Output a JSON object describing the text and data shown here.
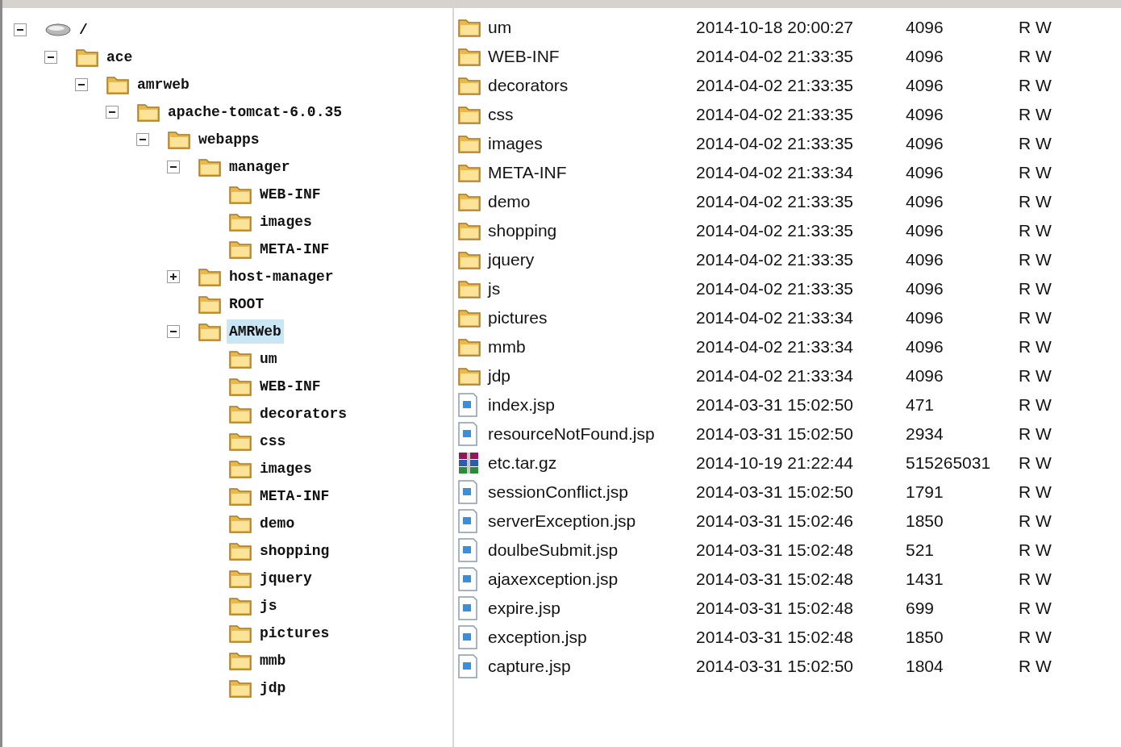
{
  "tree": [
    {
      "label": "/",
      "kind": "drive",
      "expanded": true,
      "selected": false,
      "children": [
        {
          "label": "ace",
          "kind": "folder",
          "expanded": true,
          "selected": false,
          "children": [
            {
              "label": "amrweb",
              "kind": "folder",
              "expanded": true,
              "selected": false,
              "children": [
                {
                  "label": "apache-tomcat-6.0.35",
                  "kind": "folder",
                  "expanded": true,
                  "selected": false,
                  "children": [
                    {
                      "label": "webapps",
                      "kind": "folder",
                      "expanded": true,
                      "selected": false,
                      "children": [
                        {
                          "label": "manager",
                          "kind": "folder",
                          "expanded": true,
                          "selected": false,
                          "children": [
                            {
                              "label": "WEB-INF",
                              "kind": "folder",
                              "selected": false
                            },
                            {
                              "label": "images",
                              "kind": "folder",
                              "selected": false
                            },
                            {
                              "label": "META-INF",
                              "kind": "folder",
                              "selected": false
                            }
                          ]
                        },
                        {
                          "label": "host-manager",
                          "kind": "folder",
                          "expanded": false,
                          "selected": false
                        },
                        {
                          "label": "ROOT",
                          "kind": "folder",
                          "selected": false
                        },
                        {
                          "label": "AMRWeb",
                          "kind": "folder",
                          "expanded": true,
                          "selected": true,
                          "children": [
                            {
                              "label": "um",
                              "kind": "folder",
                              "selected": false
                            },
                            {
                              "label": "WEB-INF",
                              "kind": "folder",
                              "selected": false
                            },
                            {
                              "label": "decorators",
                              "kind": "folder",
                              "selected": false
                            },
                            {
                              "label": "css",
                              "kind": "folder",
                              "selected": false
                            },
                            {
                              "label": "images",
                              "kind": "folder",
                              "selected": false
                            },
                            {
                              "label": "META-INF",
                              "kind": "folder",
                              "selected": false
                            },
                            {
                              "label": "demo",
                              "kind": "folder",
                              "selected": false
                            },
                            {
                              "label": "shopping",
                              "kind": "folder",
                              "selected": false
                            },
                            {
                              "label": "jquery",
                              "kind": "folder",
                              "selected": false
                            },
                            {
                              "label": "js",
                              "kind": "folder",
                              "selected": false
                            },
                            {
                              "label": "pictures",
                              "kind": "folder",
                              "selected": false
                            },
                            {
                              "label": "mmb",
                              "kind": "folder",
                              "selected": false
                            },
                            {
                              "label": "jdp",
                              "kind": "folder",
                              "selected": false
                            }
                          ]
                        }
                      ]
                    }
                  ]
                }
              ]
            }
          ]
        }
      ]
    }
  ],
  "files": [
    {
      "kind": "folder",
      "name": "um",
      "modified": "2014-10-18 20:00:27",
      "size": "4096",
      "access": "R W"
    },
    {
      "kind": "folder",
      "name": "WEB-INF",
      "modified": "2014-04-02 21:33:35",
      "size": "4096",
      "access": "R W"
    },
    {
      "kind": "folder",
      "name": "decorators",
      "modified": "2014-04-02 21:33:35",
      "size": "4096",
      "access": "R W"
    },
    {
      "kind": "folder",
      "name": "css",
      "modified": "2014-04-02 21:33:35",
      "size": "4096",
      "access": "R W"
    },
    {
      "kind": "folder",
      "name": "images",
      "modified": "2014-04-02 21:33:35",
      "size": "4096",
      "access": "R W"
    },
    {
      "kind": "folder",
      "name": "META-INF",
      "modified": "2014-04-02 21:33:34",
      "size": "4096",
      "access": "R W"
    },
    {
      "kind": "folder",
      "name": "demo",
      "modified": "2014-04-02 21:33:35",
      "size": "4096",
      "access": "R W"
    },
    {
      "kind": "folder",
      "name": "shopping",
      "modified": "2014-04-02 21:33:35",
      "size": "4096",
      "access": "R W"
    },
    {
      "kind": "folder",
      "name": "jquery",
      "modified": "2014-04-02 21:33:35",
      "size": "4096",
      "access": "R W"
    },
    {
      "kind": "folder",
      "name": "js",
      "modified": "2014-04-02 21:33:35",
      "size": "4096",
      "access": "R W"
    },
    {
      "kind": "folder",
      "name": "pictures",
      "modified": "2014-04-02 21:33:34",
      "size": "4096",
      "access": "R W"
    },
    {
      "kind": "folder",
      "name": "mmb",
      "modified": "2014-04-02 21:33:34",
      "size": "4096",
      "access": "R W"
    },
    {
      "kind": "folder",
      "name": "jdp",
      "modified": "2014-04-02 21:33:34",
      "size": "4096",
      "access": "R W"
    },
    {
      "kind": "file",
      "name": "index.jsp",
      "modified": "2014-03-31 15:02:50",
      "size": "471",
      "access": "R W"
    },
    {
      "kind": "file",
      "name": "resourceNotFound.jsp",
      "modified": "2014-03-31 15:02:50",
      "size": "2934",
      "access": "R W"
    },
    {
      "kind": "archive",
      "name": "etc.tar.gz",
      "modified": "2014-10-19 21:22:44",
      "size": "515265031",
      "access": "R W"
    },
    {
      "kind": "file",
      "name": "sessionConflict.jsp",
      "modified": "2014-03-31 15:02:50",
      "size": "1791",
      "access": "R W"
    },
    {
      "kind": "file",
      "name": "serverException.jsp",
      "modified": "2014-03-31 15:02:46",
      "size": "1850",
      "access": "R W"
    },
    {
      "kind": "file",
      "name": "doulbeSubmit.jsp",
      "modified": "2014-03-31 15:02:48",
      "size": "521",
      "access": "R W"
    },
    {
      "kind": "file",
      "name": "ajaxexception.jsp",
      "modified": "2014-03-31 15:02:48",
      "size": "1431",
      "access": "R W"
    },
    {
      "kind": "file",
      "name": "expire.jsp",
      "modified": "2014-03-31 15:02:48",
      "size": "699",
      "access": "R W"
    },
    {
      "kind": "file",
      "name": "exception.jsp",
      "modified": "2014-03-31 15:02:48",
      "size": "1850",
      "access": "R W"
    },
    {
      "kind": "file",
      "name": "capture.jsp",
      "modified": "2014-03-31 15:02:50",
      "size": "1804",
      "access": "R W"
    }
  ]
}
